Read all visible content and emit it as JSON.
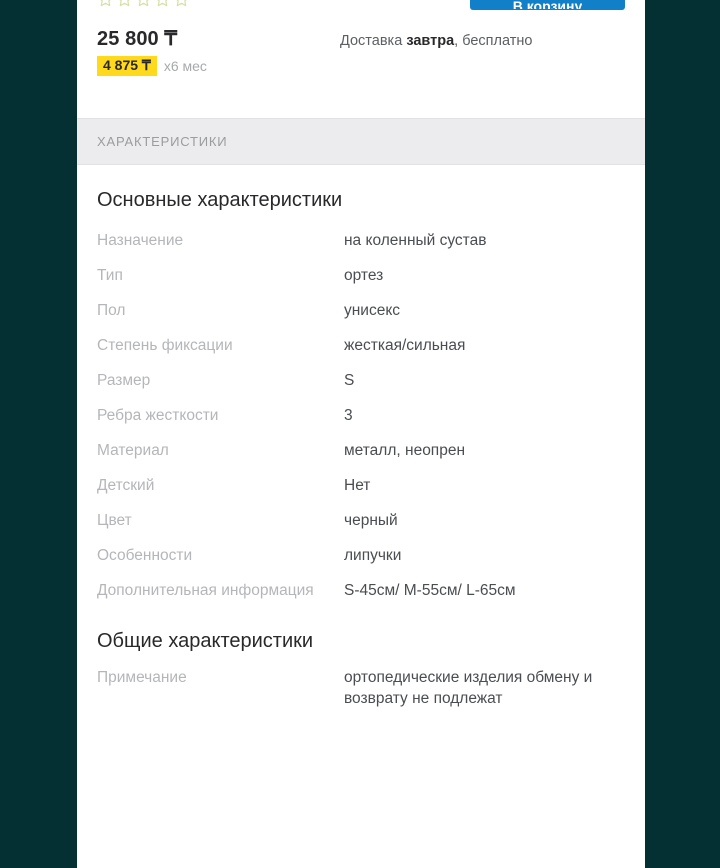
{
  "colors": {
    "frame": "#043034",
    "page": "#ffffff",
    "tab_band": "#ececee",
    "cta_blue": "#1180c8",
    "credit_badge_yellow": "#ffd91c",
    "star_outline": "#d7dfa8",
    "label_gray": "#b4b6b9",
    "value_gray": "#4a4d51"
  },
  "rating": {
    "icon": "star-outline-icon",
    "count": 5,
    "filled": 0
  },
  "cta": {
    "label": "В корзину"
  },
  "price": {
    "amount": "25 800 ₸",
    "credit_amount": "4 875 ₸",
    "credit_term": "x6 мес"
  },
  "delivery": {
    "prefix": "Доставка ",
    "emphasis": "завтра",
    "suffix": ", бесплатно"
  },
  "tabs": [
    {
      "label": "ХАРАКТЕРИСТИКИ"
    }
  ],
  "spec_groups": [
    {
      "title": "Основные характеристики",
      "rows": [
        {
          "label": "Назначение",
          "value": "на коленный сустав"
        },
        {
          "label": "Тип",
          "value": "ортез"
        },
        {
          "label": "Пол",
          "value": "унисекс"
        },
        {
          "label": "Степень фиксации",
          "value": "жесткая/сильная"
        },
        {
          "label": "Размер",
          "value": "S"
        },
        {
          "label": "Ребра жесткости",
          "value": "3"
        },
        {
          "label": "Материал",
          "value": "металл, неопрен"
        },
        {
          "label": "Детский",
          "value": "Нет"
        },
        {
          "label": "Цвет",
          "value": "черный"
        },
        {
          "label": "Особенности",
          "value": "липучки"
        },
        {
          "label": "Дополнительная информация",
          "value": "S-45см/ M-55см/ L-65см"
        }
      ]
    },
    {
      "title": "Общие характеристики",
      "rows": [
        {
          "label": "Примечание",
          "value": "ортопедические изделия обмену и возврату не подлежат"
        }
      ]
    }
  ]
}
